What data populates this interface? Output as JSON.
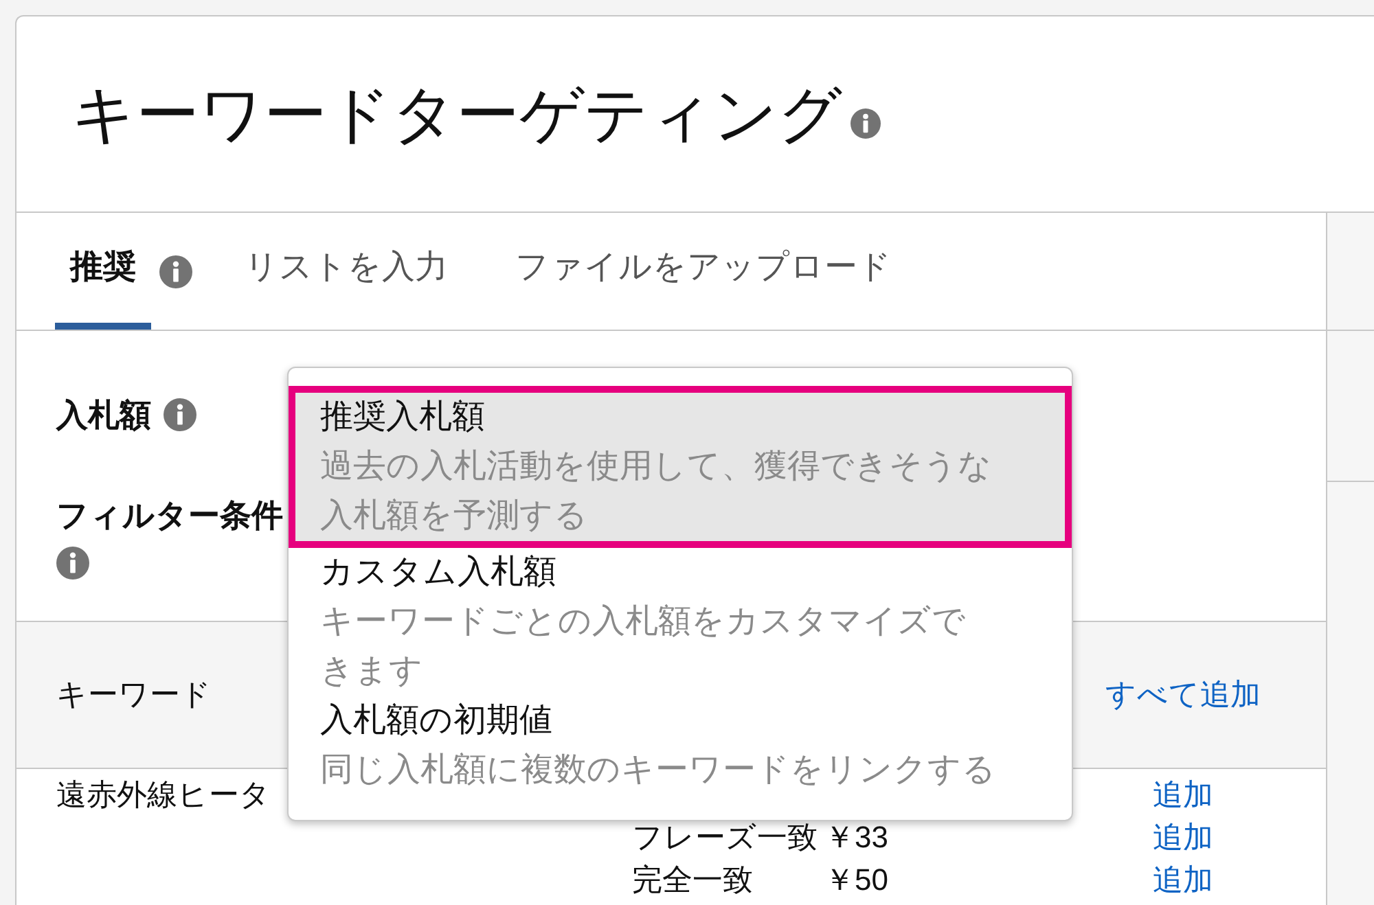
{
  "header": {
    "title": "キーワードターゲティング"
  },
  "tabs": [
    {
      "label": "推奨",
      "selected": true,
      "info": true
    },
    {
      "label": "リストを入力",
      "selected": false,
      "info": false
    },
    {
      "label": "ファイルをアップロード",
      "selected": false,
      "info": false
    }
  ],
  "settings": [
    {
      "label": "入札額"
    },
    {
      "label": "フィルター条件"
    }
  ],
  "bid_menu": {
    "options": [
      {
        "title": "推奨入札額",
        "description": "過去の入札活動を使用して、獲得できそうな入札額を予測する",
        "selected": true,
        "annotated": true
      },
      {
        "title": "カスタム入札額",
        "description": "キーワードごとの入札額をカスタマイズできます",
        "selected": false,
        "annotated": false
      },
      {
        "title": "入札額の初期値",
        "description": "同じ入札額に複数のキーワードをリンクする",
        "selected": false,
        "annotated": false
      }
    ]
  },
  "table": {
    "keyword_header": "キーワード",
    "add_all": "すべて追加",
    "rows": [
      {
        "keyword": "遠赤外線ヒータ",
        "action": "追加"
      },
      {
        "match_type": "フレーズ一致",
        "bid": "￥33",
        "action": "追加"
      },
      {
        "match_type": "完全一致",
        "bid": "￥50",
        "action": "追加"
      }
    ]
  }
}
